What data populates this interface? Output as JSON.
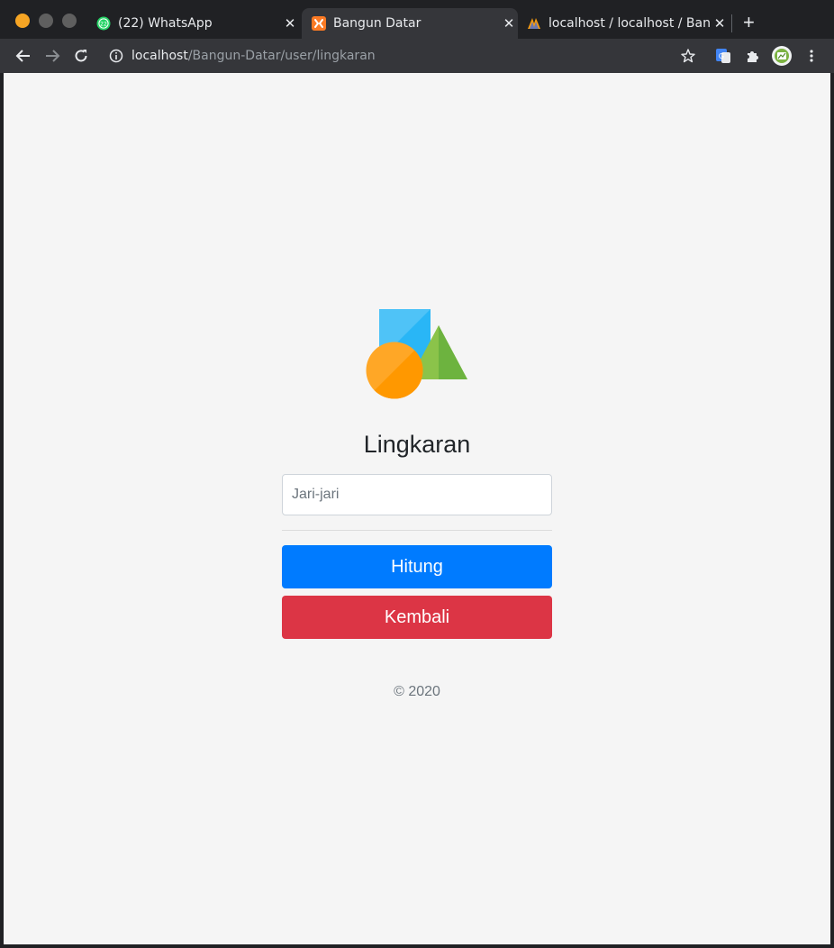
{
  "browser": {
    "tabs": [
      {
        "title": "(22) WhatsApp",
        "badge": "22",
        "favicon": "whatsapp-icon"
      },
      {
        "title": "Bangun Datar",
        "favicon": "xampp-icon",
        "active": true
      },
      {
        "title": "localhost / localhost / Bangun",
        "favicon": "phpmyadmin-icon"
      }
    ],
    "url_host": "localhost",
    "url_path": "/Bangun-Datar/user/lingkaran"
  },
  "page": {
    "heading": "Lingkaran",
    "input_placeholder": "Jari-jari",
    "hitung_label": "Hitung",
    "kembali_label": "Kembali",
    "footer": "© 2020"
  },
  "colors": {
    "primary": "#007bff",
    "danger": "#dc3545",
    "background": "#f5f5f5"
  }
}
